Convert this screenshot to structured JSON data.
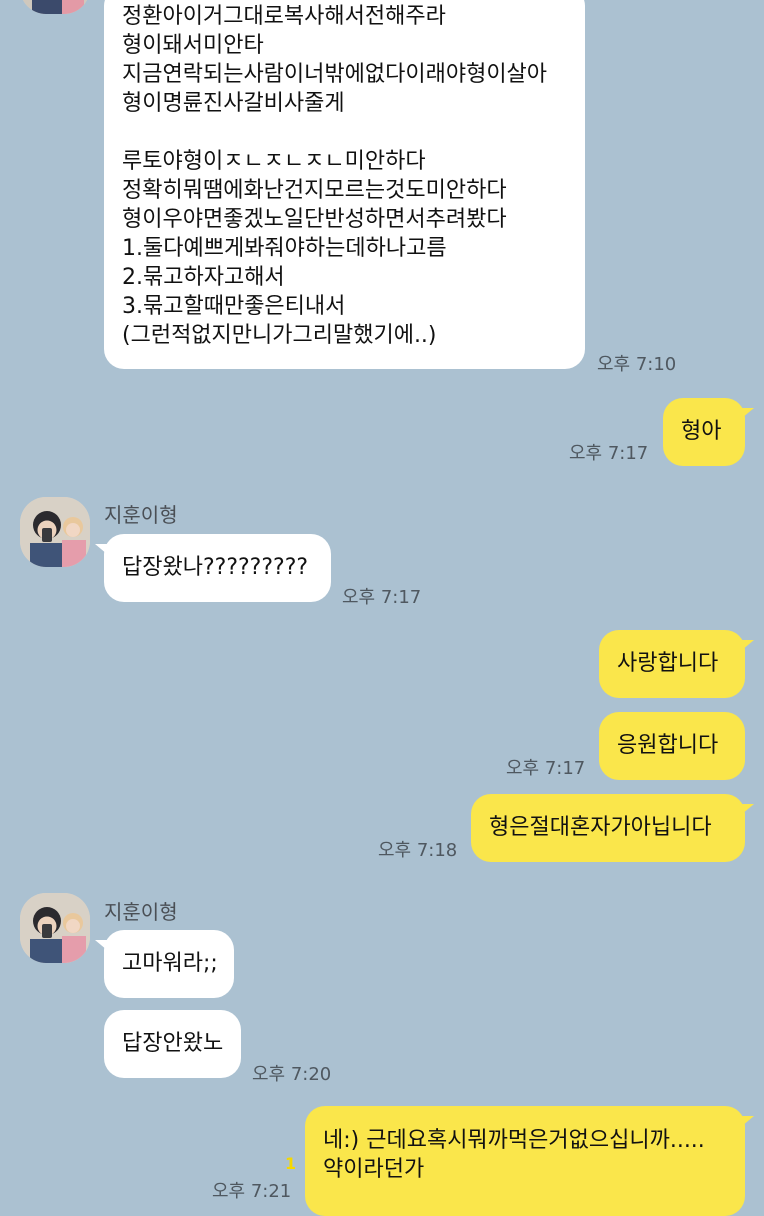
{
  "messages": {
    "m1": {
      "lines": [
        "정환아이거그대로복사해서전해주라",
        "형이돼서미안타",
        "지금연락되는사람이너밖에없다이래야형이살아",
        "형이명륜진사갈비사줄게",
        "",
        "루토야형이ㅈㄴㅈㄴㅈㄴ미안하다",
        "정확히뭐땜에화난건지모르는것도미안하다",
        "형이우야면좋겠노일단반성하면서추려봤다",
        "1.둘다예쁘게봐줘야하는데하나고름",
        "2.묶고하자고해서",
        "3.묶고할때만좋은티내서",
        "(그런적없지만니가그리말했기에..)"
      ],
      "time": "오후 7:10"
    },
    "m2": {
      "text": "형아",
      "time": "오후 7:17"
    },
    "group1": {
      "sender": "지훈이형",
      "m3": {
        "text": "답장왔나?????????",
        "time": "오후 7:17"
      }
    },
    "m4": {
      "text": "사랑합니다"
    },
    "m5": {
      "text": "응원합니다",
      "time": "오후 7:17"
    },
    "m6": {
      "text": "형은절대혼자가아닙니다",
      "time": "오후 7:18"
    },
    "group2": {
      "sender": "지훈이형",
      "m7": {
        "text": "고마워라;;"
      },
      "m8": {
        "text": "답장안왔노",
        "time": "오후 7:20"
      }
    },
    "m9": {
      "lines": [
        "네:) 근데요혹시뭐까먹은거없으십니까.....",
        "약이라던가"
      ],
      "unread": "1",
      "time": "오후 7:21"
    }
  },
  "colors": {
    "background": "#abc1d1",
    "incoming_bubble": "#ffffff",
    "outgoing_bubble": "#fae64b",
    "unread_count": "#f5d800"
  }
}
